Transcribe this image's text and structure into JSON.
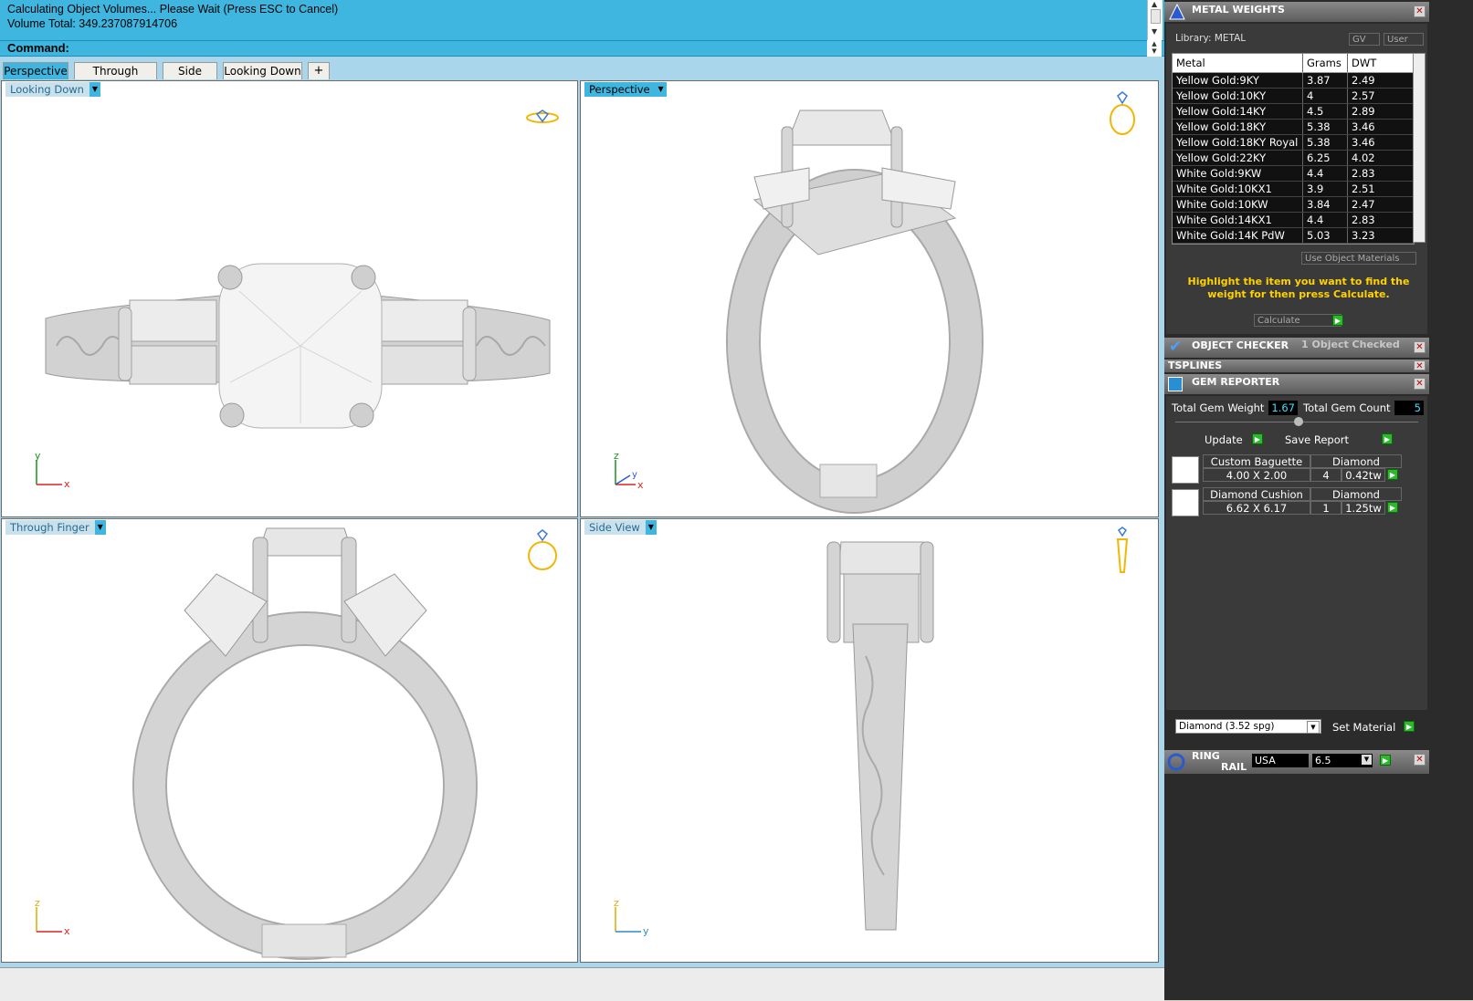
{
  "command": {
    "lines": [
      "Calculating Object Volumes... Please Wait (Press ESC to Cancel)",
      "Volume Total: 349.237087914706"
    ],
    "prompt": "Command:"
  },
  "tabs": [
    "Perspective",
    "Through Finger",
    "Side View",
    "Looking Down"
  ],
  "viewports": {
    "looking_down": {
      "label": "Looking Down",
      "axis_v": "y",
      "axis_h": "x"
    },
    "perspective": {
      "label": "Perspective",
      "axis_v": "z",
      "axis_h": "x",
      "axis_3": "y"
    },
    "through_finger": {
      "label": "Through Finger",
      "axis_v": "z",
      "axis_h": "x"
    },
    "side_view": {
      "label": "Side View",
      "axis_v": "z",
      "axis_h": "y"
    }
  },
  "metal_weights": {
    "title": "METAL WEIGHTS",
    "library": "Library: METAL",
    "gv": "GV",
    "user": "User",
    "columns": [
      "Metal",
      "Grams",
      "DWT"
    ],
    "rows": [
      [
        "Yellow Gold:9KY",
        "3.87",
        "2.49"
      ],
      [
        "Yellow Gold:10KY",
        "4",
        "2.57"
      ],
      [
        "Yellow Gold:14KY",
        "4.5",
        "2.89"
      ],
      [
        "Yellow Gold:18KY",
        "5.38",
        "3.46"
      ],
      [
        "Yellow Gold:18KY Royal",
        "5.38",
        "3.46"
      ],
      [
        "Yellow Gold:22KY",
        "6.25",
        "4.02"
      ],
      [
        "White Gold:9KW",
        "4.4",
        "2.83"
      ],
      [
        "White Gold:10KX1",
        "3.9",
        "2.51"
      ],
      [
        "White Gold:10KW",
        "3.84",
        "2.47"
      ],
      [
        "White Gold:14KX1",
        "4.4",
        "2.83"
      ],
      [
        "White Gold:14K PdW",
        "5.03",
        "3.23"
      ]
    ],
    "use_object_materials": "Use Object Materials",
    "hint": "Highlight the item you want to find the weight for then press Calculate.",
    "calculate": "Calculate"
  },
  "object_checker": {
    "title": "OBJECT CHECKER",
    "status": "1 Object Checked"
  },
  "tsplines": {
    "title": "TSPLINES"
  },
  "gem_reporter": {
    "title": "GEM REPORTER",
    "total_weight_label": "Total Gem Weight",
    "total_weight": "1.67",
    "total_count_label": "Total Gem Count",
    "total_count": "5",
    "update": "Update",
    "save_report": "Save Report",
    "gems": [
      {
        "name": "Custom Baguette",
        "size": "4.00 X 2.00",
        "material": "Diamond",
        "count": "4",
        "weight": "0.42tw"
      },
      {
        "name": "Diamond Cushion",
        "size": "6.62 X 6.17",
        "material": "Diamond",
        "count": "1",
        "weight": "1.25tw"
      }
    ],
    "material_select": "Diamond      (3.52 spg)",
    "set_material": "Set Material"
  },
  "ring_rail": {
    "title1": "RING",
    "title2": "RAIL",
    "standard": "USA",
    "size": "6.5"
  },
  "colors": {
    "accent": "#3eb6df",
    "gold_icon": "#f2b705",
    "go_green": "#2db92d",
    "field_cyan": "#3ee0ff"
  }
}
